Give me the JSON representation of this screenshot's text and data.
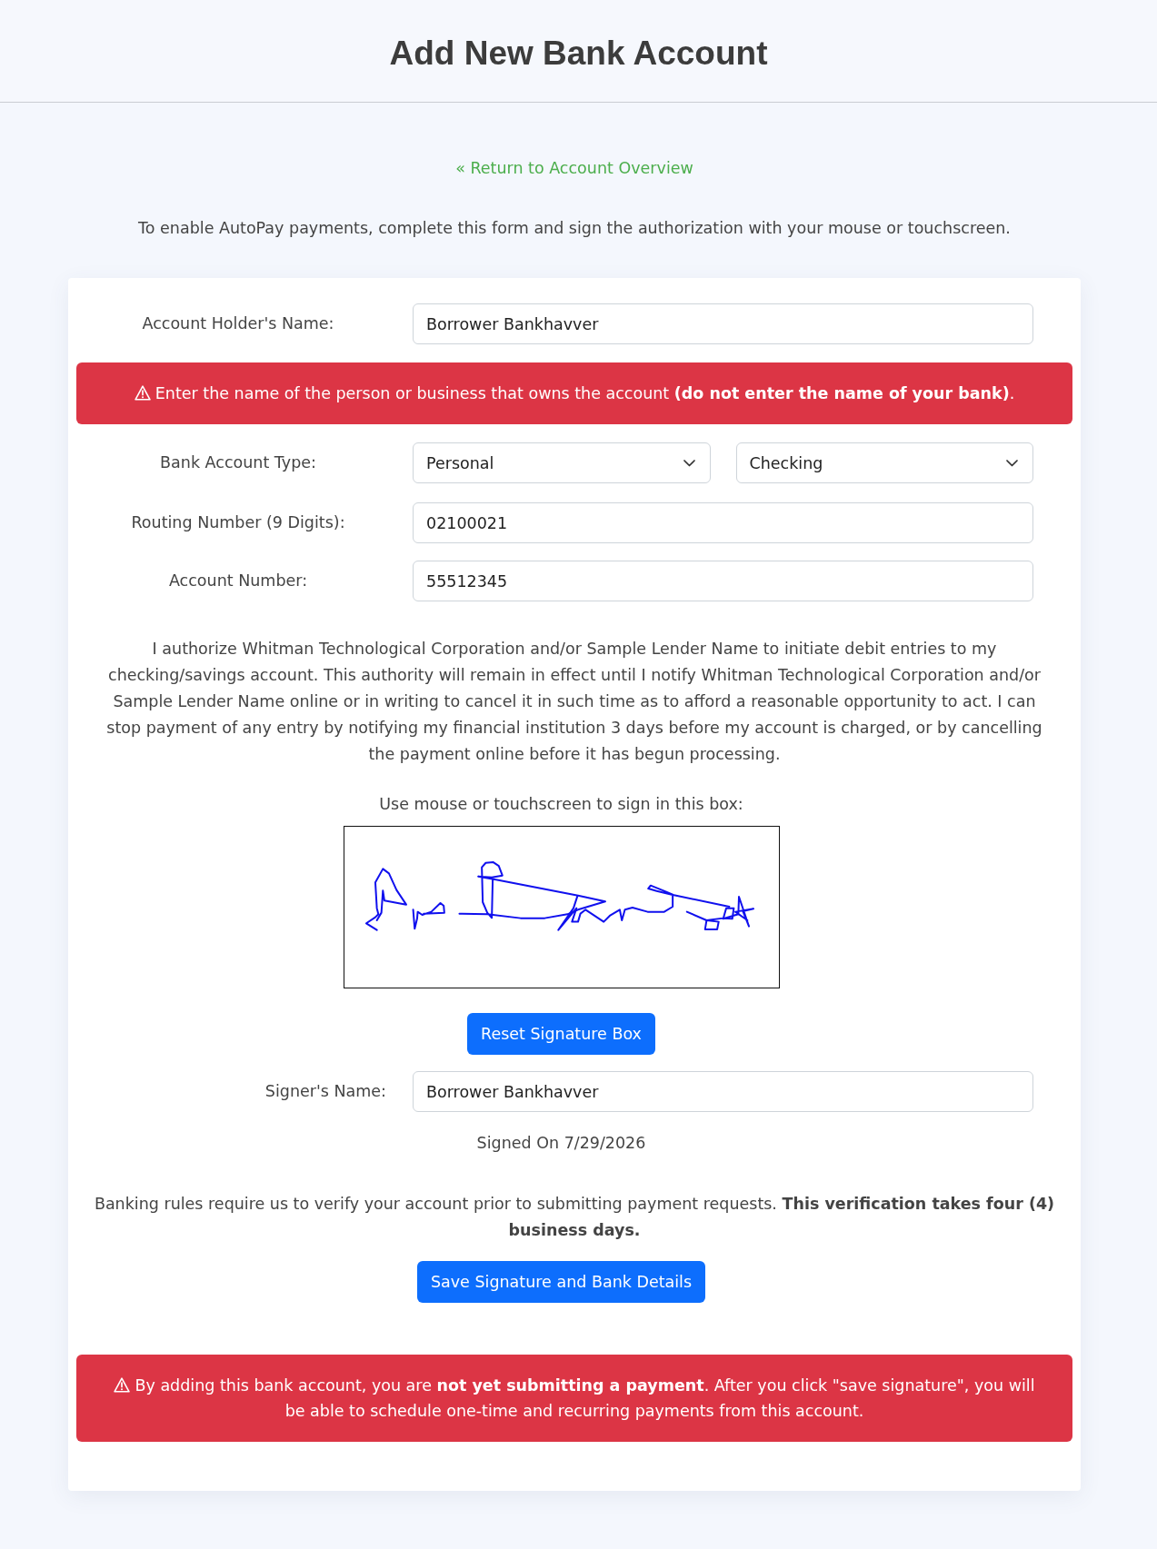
{
  "header": {
    "title": "Add New Bank Account"
  },
  "back_link": {
    "label": "« Return to Account Overview"
  },
  "intro": "To enable AutoPay payments, complete this form and sign the authorization with your mouse or touchscreen.",
  "form_rows": [
    {
      "kind": "input",
      "label": "Account Holder's Name:",
      "value": "Borrower Bankhavver"
    },
    {
      "kind": "alert",
      "text": "Enter the name of the person or business that owns the account **(do not enter the name of your bank)**."
    },
    {
      "kind": "select",
      "label": "Bank Account Type:",
      "values": [
        "Personal",
        "Checking"
      ]
    },
    {
      "kind": "input",
      "label": "Routing Number (9 Digits):",
      "value": "02100021"
    },
    {
      "kind": "input",
      "label": "Account Number:",
      "value": "55512345"
    }
  ],
  "authorization": "I authorize Whitman Technological Corporation and/or Sample Lender Name to initiate debit entries to my checking/savings account. This authority will remain in effect until I notify Whitman Technological Corporation and/or Sample Lender Name online or in writing to cancel it in such time as to afford a reasonable opportunity to act. I can stop payment of any entry by notifying my financial institution 3 days before my account is charged, or by cancelling the payment online before it has begun processing.",
  "signature": {
    "prompt": "Use mouse or touchscreen to sign in this box:",
    "reset_button": "Reset Signature Box",
    "signer_label": "Signer's Name:",
    "signer_value": "Borrower Bankhavver",
    "signed_on": "Signed On 7/29/2026"
  },
  "verification_note": "Banking rules require us to verify your account prior to submitting payment requests. **This verification takes four (4) business days.**",
  "save_button": "Save Signature and Bank Details",
  "bottom_alert": "By adding this bank account, you are **not yet submitting a payment**. After you click \"save signature\", you will be able to schedule one-time and recurring payments from this account."
}
